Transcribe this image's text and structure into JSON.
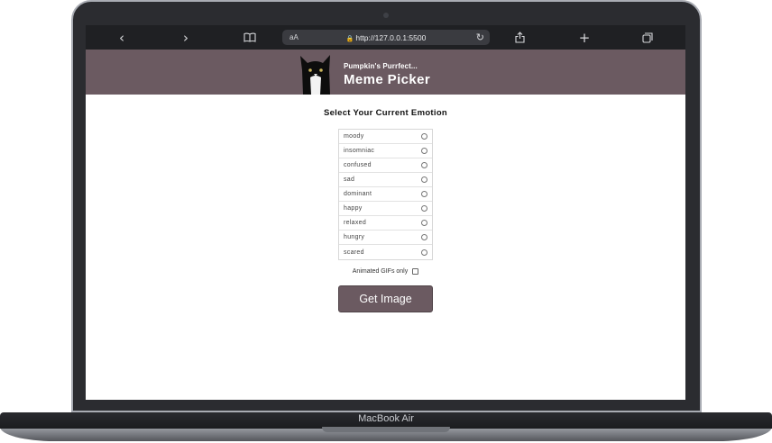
{
  "browser": {
    "back_icon": "chevron-left-icon",
    "forward_icon": "chevron-right-icon",
    "bookmarks_icon": "book-icon",
    "text_size_label": "aA",
    "url": "http://127.0.0.1:5500",
    "reload_icon": "reload-icon",
    "share_icon": "share-icon",
    "new_tab_icon": "plus-icon",
    "tabs_icon": "tabs-icon"
  },
  "header": {
    "subtitle": "Pumpkin's Purrfect...",
    "title": "Meme Picker",
    "background_color": "#6b5a61"
  },
  "main": {
    "heading": "Select Your Current Emotion",
    "emotions": [
      "moody",
      "insomniac",
      "confused",
      "sad",
      "dominant",
      "happy",
      "relaxed",
      "hungry",
      "scared"
    ],
    "gifs_only_label": "Animated GIFs only",
    "gifs_only_checked": false,
    "submit_label": "Get Image"
  },
  "device": {
    "label": "MacBook Air"
  }
}
